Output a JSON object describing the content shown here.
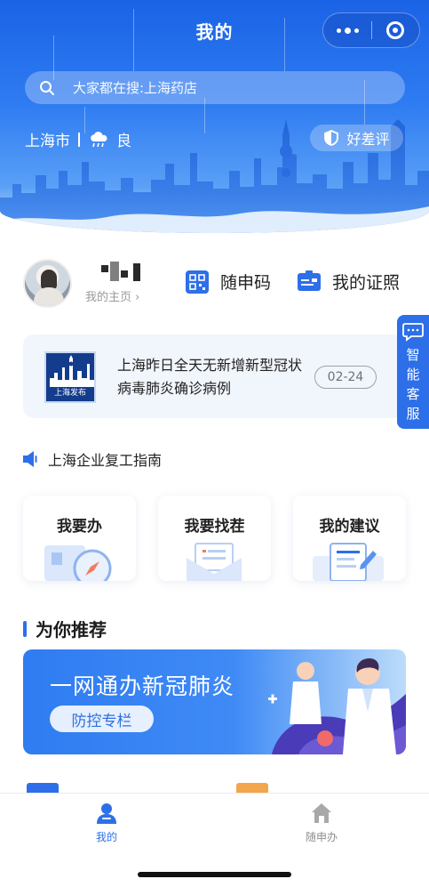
{
  "header": {
    "title": "我的",
    "more_icon": "more-dots-icon",
    "close_icon": "target-circle-icon"
  },
  "search": {
    "placeholder": "大家都在搜:上海药店",
    "icon": "search-icon"
  },
  "location": {
    "city": "上海市",
    "weather_icon": "rain-cloud-icon",
    "air_quality": "良"
  },
  "review_button": {
    "label": "好差评",
    "icon": "shield-half-icon"
  },
  "profile": {
    "homepage_link": "我的主页 ›"
  },
  "quick_actions": [
    {
      "label": "随申码",
      "icon": "qr-code-icon"
    },
    {
      "label": "我的证照",
      "icon": "id-card-icon"
    }
  ],
  "news": {
    "source_logo_label": "上海发布",
    "headline": "上海昨日全天无新增新型冠状病毒肺炎确诊病例",
    "date": "02-24"
  },
  "assistant": {
    "label": "智能客服",
    "icon": "chat-bubble-icon"
  },
  "guide": {
    "label": "上海企业复工指南",
    "icon": "speaker-icon"
  },
  "service_cards": [
    {
      "label": "我要办",
      "art": "compass-document-icon"
    },
    {
      "label": "我要找茬",
      "art": "envelope-letter-icon"
    },
    {
      "label": "我的建议",
      "art": "edit-document-icon"
    }
  ],
  "recommend": {
    "title": "为你推荐",
    "banner_headline": "一网通办新冠肺炎",
    "banner_button": "防控专栏"
  },
  "tabbar": [
    {
      "label": "我的",
      "icon": "person-icon",
      "active": true
    },
    {
      "label": "随申办",
      "icon": "home-icon",
      "active": false
    }
  ],
  "colors": {
    "primary": "#2d6fe8",
    "hero_top": "#1a63e6",
    "tab_inactive": "#8e8e8e",
    "card_bg": "#f1f5fc"
  }
}
